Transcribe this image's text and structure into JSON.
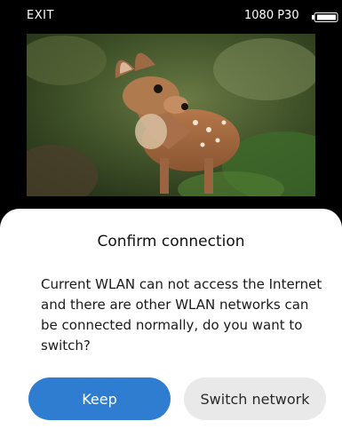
{
  "status_bar": {
    "exit_label": "EXIT",
    "resolution": "1080 P30",
    "battery_icon": "battery-icon"
  },
  "preview": {
    "icon": "video-preview"
  },
  "dialog": {
    "title": "Confirm connection",
    "message": "Current WLAN can not access the Internet and there are other WLAN networks can be connected normally, do you want to switch?",
    "keep_label": "Keep",
    "switch_label": "Switch network"
  },
  "colors": {
    "primary_button": "#2f7dd1",
    "secondary_button": "#e9e9e9",
    "dialog_bg": "#ffffff",
    "screen_bg": "#000000"
  }
}
